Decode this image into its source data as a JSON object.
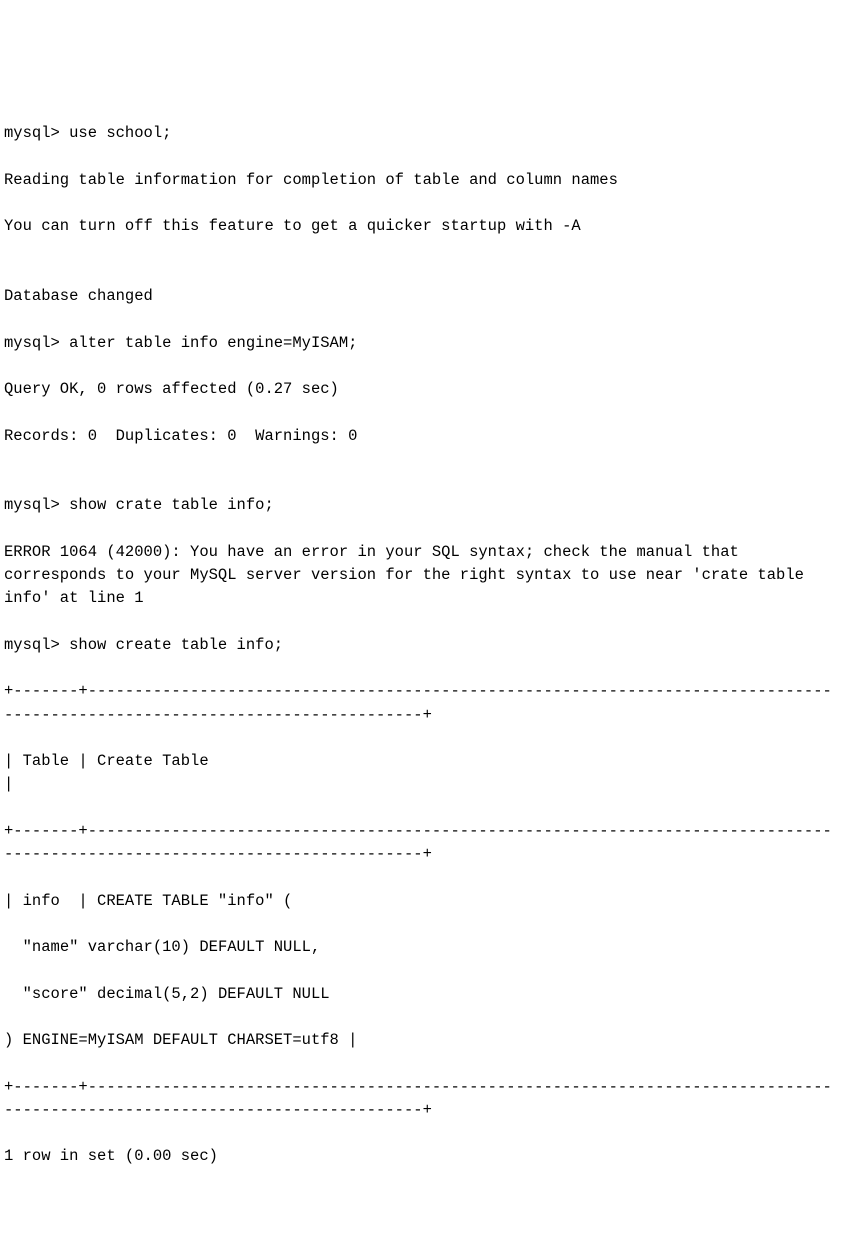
{
  "lines": {
    "l1": "mysql> use school;",
    "l2": "Reading table information for completion of table and column names",
    "l3": "You can turn off this feature to get a quicker startup with -A",
    "l4": "",
    "l5": "Database changed",
    "l6": "mysql> alter table info engine=MyISAM;",
    "l7": "Query OK, 0 rows affected (0.27 sec)",
    "l8": "Records: 0  Duplicates: 0  Warnings: 0",
    "l9": "",
    "l10": "mysql> show crate table info;",
    "l11": "ERROR 1064 (42000): You have an error in your SQL syntax; check the manual that corresponds to your MySQL server version for the right syntax to use near 'crate table info' at line 1",
    "l12": "mysql> show create table info;",
    "l13": "+-------+-----------------------------------------------------------------------------------------------------------------------------+",
    "l14": "| Table | Create Table                                                                                                                |",
    "l15": "+-------+-----------------------------------------------------------------------------------------------------------------------------+",
    "l16": "| info  | CREATE TABLE \"info\" (",
    "l17": "  \"name\" varchar(10) DEFAULT NULL,",
    "l18": "  \"score\" decimal(5,2) DEFAULT NULL",
    "l19": ") ENGINE=MyISAM DEFAULT CHARSET=utf8 |",
    "l20": "+-------+-----------------------------------------------------------------------------------------------------------------------------+",
    "l21": "1 row in set (0.00 sec)"
  }
}
